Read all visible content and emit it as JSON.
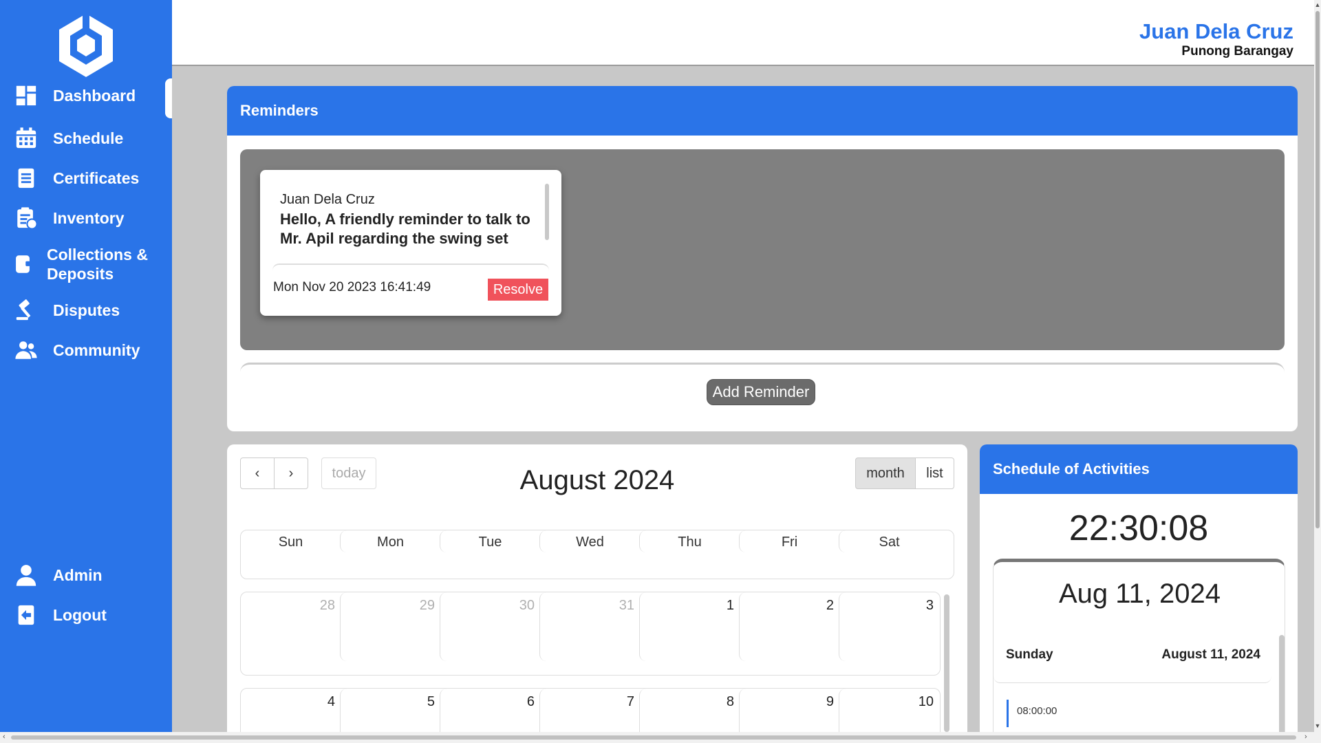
{
  "header": {
    "user_name": "Juan Dela Cruz",
    "user_role": "Punong Barangay"
  },
  "sidebar": {
    "items": [
      {
        "label": "Dashboard",
        "icon": "dashboard-icon",
        "active": true
      },
      {
        "label": "Schedule",
        "icon": "calendar-icon"
      },
      {
        "label": "Certificates",
        "icon": "document-icon"
      },
      {
        "label": "Inventory",
        "icon": "inventory-icon"
      },
      {
        "label": "Collections &\nDeposits",
        "icon": "wallet-icon"
      },
      {
        "label": "Disputes",
        "icon": "gavel-icon"
      },
      {
        "label": "Community",
        "icon": "people-icon"
      }
    ],
    "bottom": [
      {
        "label": "Admin",
        "icon": "user-icon"
      },
      {
        "label": "Logout",
        "icon": "logout-icon"
      }
    ]
  },
  "reminders": {
    "title": "Reminders",
    "note": {
      "author": "Juan Dela Cruz",
      "text": "Hello, A friendly reminder to talk to Mr. Apil regarding the swing set",
      "date": "Mon Nov 20 2023 16:41:49",
      "resolve_label": "Resolve"
    },
    "add_label": "Add Reminder"
  },
  "calendar": {
    "prev_label": "‹",
    "next_label": "›",
    "today_label": "today",
    "title": "August 2024",
    "month_label": "month",
    "list_label": "list",
    "weekdays": [
      "Sun",
      "Mon",
      "Tue",
      "Wed",
      "Thu",
      "Fri",
      "Sat"
    ],
    "weeks": [
      [
        {
          "d": "28",
          "other": true
        },
        {
          "d": "29",
          "other": true
        },
        {
          "d": "30",
          "other": true
        },
        {
          "d": "31",
          "other": true
        },
        {
          "d": "1"
        },
        {
          "d": "2"
        },
        {
          "d": "3"
        }
      ],
      [
        {
          "d": "4"
        },
        {
          "d": "5"
        },
        {
          "d": "6"
        },
        {
          "d": "7"
        },
        {
          "d": "8"
        },
        {
          "d": "9"
        },
        {
          "d": "10"
        }
      ]
    ]
  },
  "schedule": {
    "title": "Schedule of Activities",
    "clock": "22:30:08",
    "date": "Aug 11, 2024",
    "day_name": "Sunday",
    "day_full": "August 11, 2024",
    "event_time": "08:00:00"
  },
  "colors": {
    "primary": "#2a74e8",
    "resolve": "#f0525b",
    "reminder_area": "#808080"
  }
}
